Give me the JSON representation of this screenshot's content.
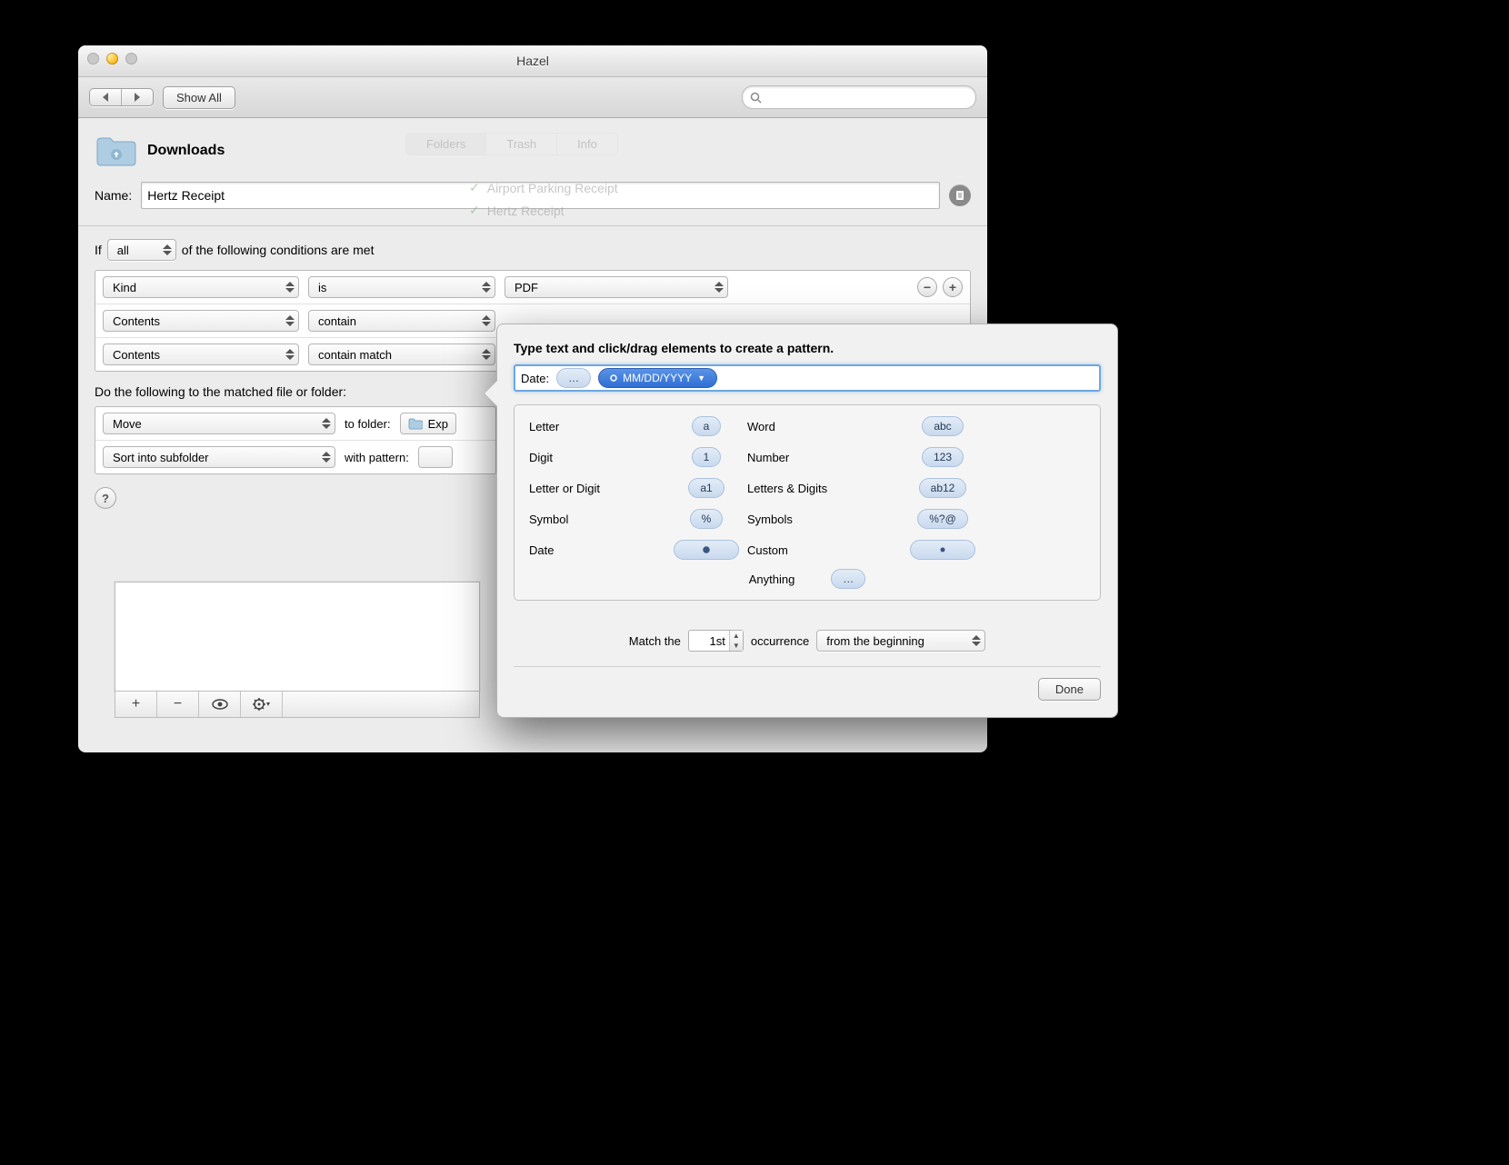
{
  "window": {
    "title": "Hazel",
    "show_all": "Show All",
    "search_placeholder": ""
  },
  "ghost": {
    "tabs": [
      "Folders",
      "Trash",
      "Info"
    ],
    "rules": [
      "Airport Parking Receipt",
      "Hertz Receipt"
    ]
  },
  "folder": {
    "title": "Downloads"
  },
  "rule": {
    "name_label": "Name:",
    "name_value": "Hertz Receipt",
    "if_label": "If",
    "match_mode": "all",
    "if_suffix": "of the following conditions are met",
    "conditions": [
      {
        "attr": "Kind",
        "op": "is",
        "val": "PDF"
      },
      {
        "attr": "Contents",
        "op": "contain",
        "val": ""
      },
      {
        "attr": "Contents",
        "op": "contain match",
        "val": ""
      }
    ],
    "do_label": "Do the following to the matched file or folder:",
    "actions": [
      {
        "act": "Move",
        "mid": "to folder:",
        "arg": "Exp"
      },
      {
        "act": "Sort into subfolder",
        "mid": "with pattern:",
        "arg": ""
      }
    ]
  },
  "popover": {
    "heading": "Type text and click/drag elements to create a pattern.",
    "field_label": "Date:",
    "existing_token": "…",
    "date_token": "MM/DD/YYYY",
    "tokens": {
      "letter": "Letter",
      "letter_tok": "a",
      "digit": "Digit",
      "digit_tok": "1",
      "letter_or_digit": "Letter or Digit",
      "lod_tok": "a1",
      "symbol": "Symbol",
      "symbol_tok": "%",
      "date": "Date",
      "word": "Word",
      "word_tok": "abc",
      "number": "Number",
      "number_tok": "123",
      "letters_digits": "Letters & Digits",
      "ld_tok": "ab12",
      "symbols": "Symbols",
      "symbols_tok": "%?@",
      "custom": "Custom",
      "anything": "Anything",
      "anything_tok": "…"
    },
    "match_the": "Match the",
    "occurrence_value": "1st",
    "occurrence_word": "occurrence",
    "from": "from the beginning",
    "done": "Done"
  },
  "help": "?"
}
